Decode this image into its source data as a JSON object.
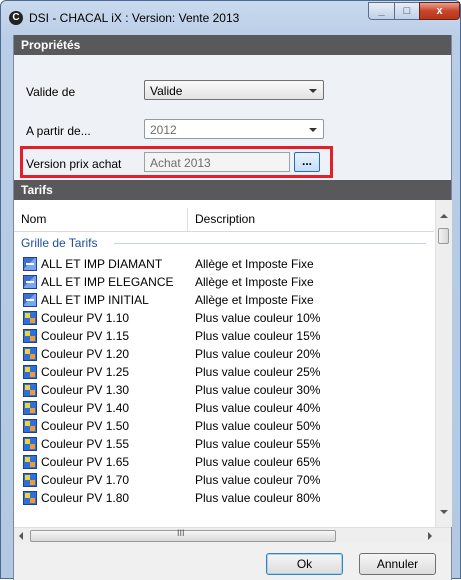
{
  "window": {
    "title": "DSI - CHACAL iX : Version: Vente 2013",
    "app_icon": "C",
    "close_glyph": "x"
  },
  "properties": {
    "header": "Propriétés",
    "valide_de": {
      "label": "Valide de",
      "value": "Valide"
    },
    "a_partir_de": {
      "label": "A partir de...",
      "value": "2012"
    },
    "version_prix_achat": {
      "label": "Version prix achat",
      "value": "Achat 2013",
      "browse_label": "..."
    }
  },
  "tarifs": {
    "header": "Tarifs",
    "columns": {
      "name": "Nom",
      "description": "Description"
    },
    "group": "Grille de Tarifs",
    "rows": [
      {
        "name": "ALL ET IMP DIAMANT",
        "description": "Allège et Imposte Fixe",
        "icon": "blue-grid-icon"
      },
      {
        "name": "ALL ET IMP ELEGANCE",
        "description": "Allège et Imposte Fixe",
        "icon": "blue-grid-icon"
      },
      {
        "name": "ALL ET IMP INITIAL",
        "description": "Allège et Imposte Fixe",
        "icon": "blue-grid-icon"
      },
      {
        "name": "Couleur PV 1.10",
        "description": "Plus value couleur 10%",
        "icon": "color-grid-icon"
      },
      {
        "name": "Couleur PV 1.15",
        "description": "Plus value couleur 15%",
        "icon": "color-grid-icon"
      },
      {
        "name": "Couleur PV 1.20",
        "description": "Plus value couleur 20%",
        "icon": "color-grid-icon"
      },
      {
        "name": "Couleur PV 1.25",
        "description": "Plus value couleur 25%",
        "icon": "color-grid-icon"
      },
      {
        "name": "Couleur PV 1.30",
        "description": "Plus value couleur 30%",
        "icon": "color-grid-icon"
      },
      {
        "name": "Couleur PV 1.40",
        "description": "Plus value couleur 40%",
        "icon": "color-grid-icon"
      },
      {
        "name": "Couleur PV 1.50",
        "description": "Plus value couleur 50%",
        "icon": "color-grid-icon"
      },
      {
        "name": "Couleur PV 1.55",
        "description": "Plus value couleur 55%",
        "icon": "color-grid-icon"
      },
      {
        "name": "Couleur PV 1.65",
        "description": "Plus value couleur 65%",
        "icon": "color-grid-icon"
      },
      {
        "name": "Couleur PV 1.70",
        "description": "Plus value couleur 70%",
        "icon": "color-grid-icon"
      },
      {
        "name": "Couleur PV 1.80",
        "description": "Plus value couleur 80%",
        "icon": "color-grid-icon"
      }
    ],
    "hscroll_grip": "III"
  },
  "buttons": {
    "ok": "Ok",
    "cancel": "Annuler"
  },
  "colors": {
    "highlight": "#e3202a",
    "section_header": "#59595b",
    "group_text": "#1f4e99"
  }
}
